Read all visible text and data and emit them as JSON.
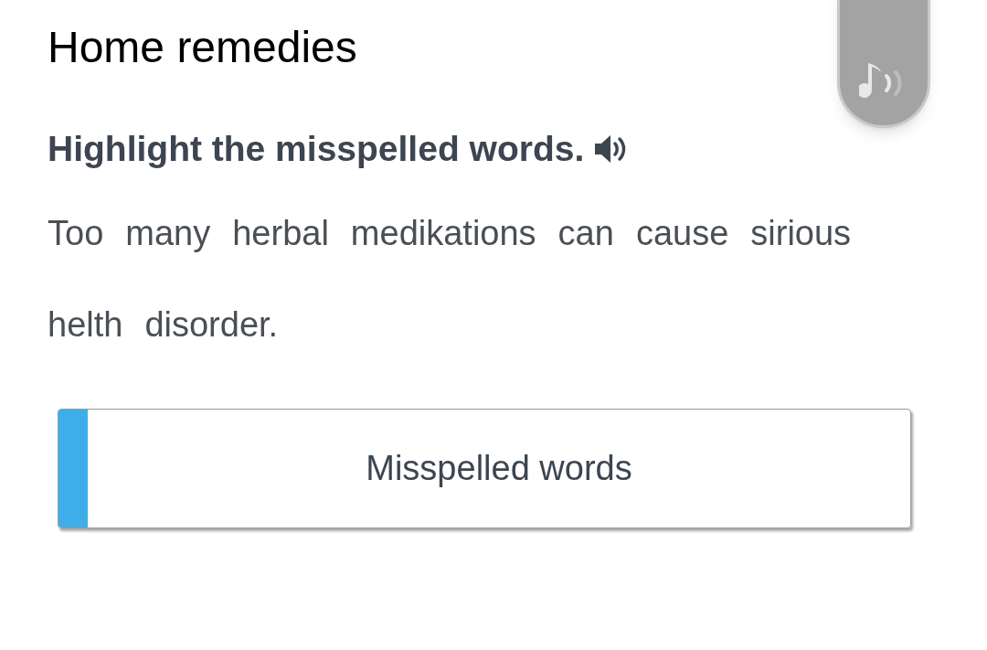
{
  "title": "Home remedies",
  "instruction": "Highlight the misspelled words.",
  "words": [
    {
      "text": "Too",
      "selected": false
    },
    {
      "text": "many",
      "selected": false
    },
    {
      "text": "herbal",
      "selected": false
    },
    {
      "text": "medikations",
      "selected": false
    },
    {
      "text": "can",
      "selected": false
    },
    {
      "text": "cause",
      "selected": false
    },
    {
      "text": "sirious",
      "selected": false
    },
    {
      "text": "helth",
      "selected": false
    },
    {
      "text": "disorder.",
      "selected": false
    }
  ],
  "answer_box": {
    "label": "Misspelled words"
  }
}
